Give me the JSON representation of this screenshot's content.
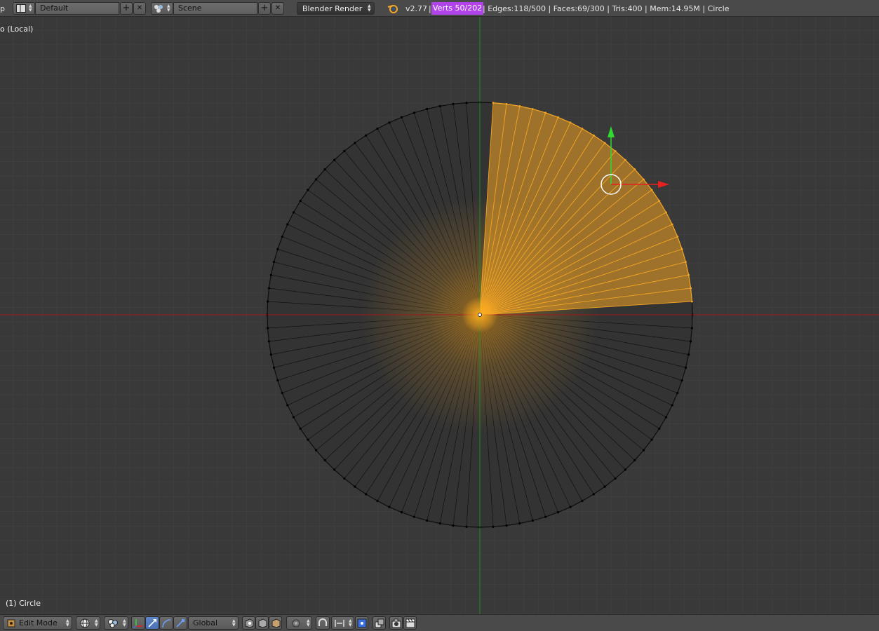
{
  "header": {
    "menu_fragment": "p",
    "screen_layout": "Default",
    "scene": "Scene",
    "render_engine": "Blender Render",
    "version": "v2.77",
    "separator": "|",
    "verts": "Verts 50/202",
    "stats_rest": "| Edges:118/500 | Faces:69/300 | Tris:400 | Mem:14.95M | Circle",
    "add_symbol": "+",
    "close_symbol": "✕"
  },
  "viewport": {
    "view_label": "o (Local)",
    "object_label": "(1) Circle"
  },
  "footer": {
    "mode": "Edit Mode",
    "orientation": "Global"
  },
  "colors": {
    "accent_selected": "#f5a623",
    "verts_highlight": "#b044e8",
    "x_axis": "#9a1a1a",
    "y_axis": "#1e8a1e"
  },
  "icons": [
    "screen-layout-icon",
    "scene-icon",
    "blender-logo-icon",
    "editor-type-icon",
    "viewport-shading-icon",
    "pivot-point-icon",
    "manipulator-icon",
    "translate-icon",
    "rotate-icon",
    "scale-icon",
    "vertex-select-icon",
    "edge-select-icon",
    "face-select-icon",
    "proportional-edit-icon",
    "snap-icon",
    "snap-element-icon",
    "render-icon",
    "camera-icon",
    "clapper-icon"
  ]
}
